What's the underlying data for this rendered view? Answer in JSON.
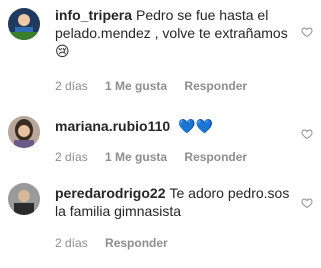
{
  "comments": [
    {
      "username": "info_tripera",
      "text": "Pedro se fue hasta el pelado.mendez , volve te extrañamos",
      "emoji": "😢",
      "time": "2 días",
      "likes": "1 Me gusta",
      "reply": "Responder"
    },
    {
      "username": "mariana.rubio110",
      "text": "",
      "emoji": "💙💙",
      "time": "2 días",
      "likes": "1 Me gusta",
      "reply": "Responder"
    },
    {
      "username": "peredarodrigo22",
      "text": "Te adoro pedro.sos la familia gimnasista",
      "emoji": "",
      "time": "2 días",
      "likes": "",
      "reply": "Responder"
    }
  ],
  "icons": {
    "like": "heart-outline-icon"
  },
  "colors": {
    "text": "#262626",
    "meta": "#8e8e8e",
    "emoji_blue_heart": "#3897f0"
  }
}
